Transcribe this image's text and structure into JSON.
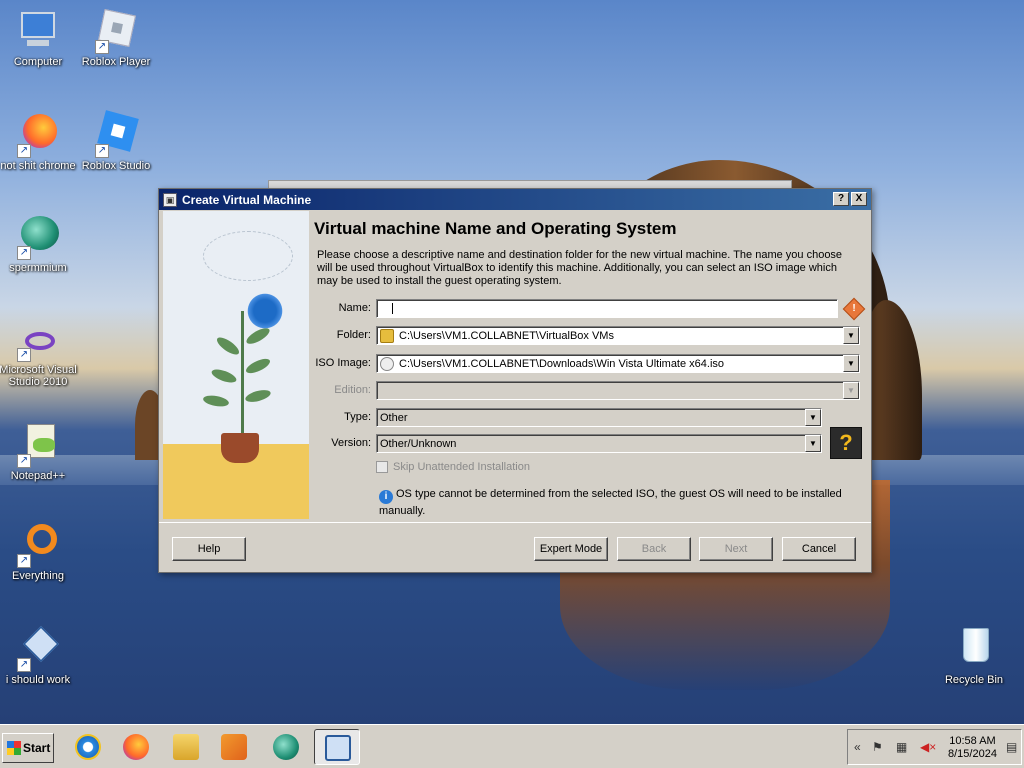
{
  "desktop": {
    "icons": [
      {
        "label": "Computer"
      },
      {
        "label": "Roblox Player"
      },
      {
        "label": "not shit chrome"
      },
      {
        "label": "Roblox Studio"
      },
      {
        "label": "spermmium"
      },
      {
        "label": "Microsoft Visual Studio 2010"
      },
      {
        "label": "Notepad++"
      },
      {
        "label": "Everything"
      },
      {
        "label": "i should work"
      },
      {
        "label": "Recycle Bin"
      }
    ]
  },
  "dialog": {
    "title": "Create Virtual Machine",
    "help_btn": "?",
    "close_btn": "X",
    "heading": "Virtual machine Name and Operating System",
    "description": "Please choose a descriptive name and destination folder for the new virtual machine. The name you choose will be used throughout VirtualBox to identify this machine. Additionally, you can select an ISO image which may be used to install the guest operating system.",
    "fields": {
      "name_label": "Name:",
      "name_value": "",
      "folder_label": "Folder:",
      "folder_value": "C:\\Users\\VM1.COLLABNET\\VirtualBox VMs",
      "iso_label": "ISO Image:",
      "iso_value": "C:\\Users\\VM1.COLLABNET\\Downloads\\Win Vista Ultimate x64.iso",
      "edition_label": "Edition:",
      "edition_value": "",
      "type_label": "Type:",
      "type_value": "Other",
      "version_label": "Version:",
      "version_value": "Other/Unknown",
      "skip_unattended_label": "Skip Unattended Installation",
      "skip_unattended_checked": false
    },
    "info_text": "OS type cannot be determined from the selected ISO, the guest OS will need to be installed manually.",
    "buttons": {
      "help": "Help",
      "expert": "Expert Mode",
      "back": "Back",
      "next": "Next",
      "cancel": "Cancel"
    }
  },
  "taskbar": {
    "start_label": "Start",
    "apps": [
      "internet-explorer-icon",
      "firefox-icon",
      "file-explorer-icon",
      "media-player-icon",
      "spermmium-icon",
      "virtualbox-icon"
    ],
    "active_app": "virtualbox-icon",
    "clock_time": "10:58 AM",
    "clock_date": "8/15/2024",
    "tray_expand": "«"
  },
  "colors": {
    "titlebar_start": "#0a246a",
    "titlebar_end": "#3a6ea5",
    "dialog_bg": "#d4d0c8",
    "warning": "#e8773a",
    "info": "#2a7ad6"
  }
}
